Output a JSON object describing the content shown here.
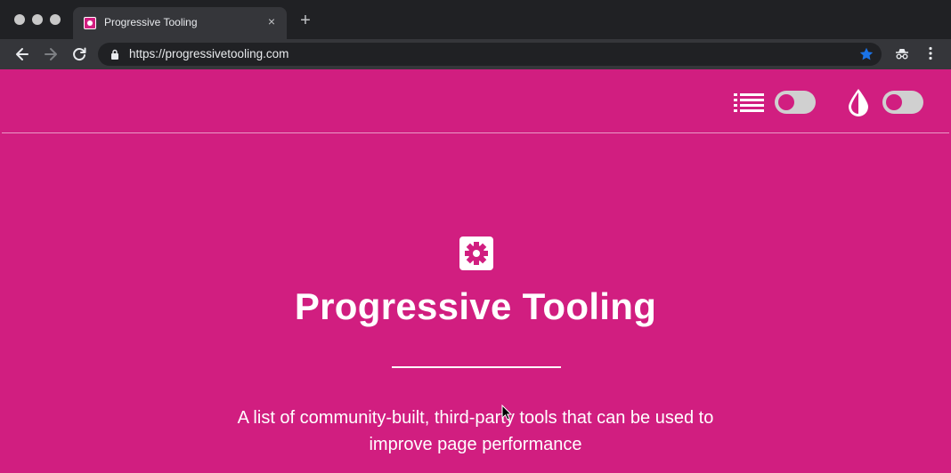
{
  "browser": {
    "tab": {
      "title": "Progressive Tooling",
      "close_glyph": "×"
    },
    "new_tab_glyph": "+",
    "url": "https://progressivetooling.com",
    "accent_color": "#1a73e8"
  },
  "page": {
    "background_color": "#d11e80",
    "header": {
      "list_toggle": {
        "icon": "list-icon",
        "state": "off"
      },
      "theme_toggle": {
        "icon": "drop-icon",
        "state": "off"
      }
    },
    "hero": {
      "icon": "gear-icon",
      "title": "Progressive Tooling",
      "description": "A list of community-built, third-party tools that can be used to improve page performance"
    }
  }
}
